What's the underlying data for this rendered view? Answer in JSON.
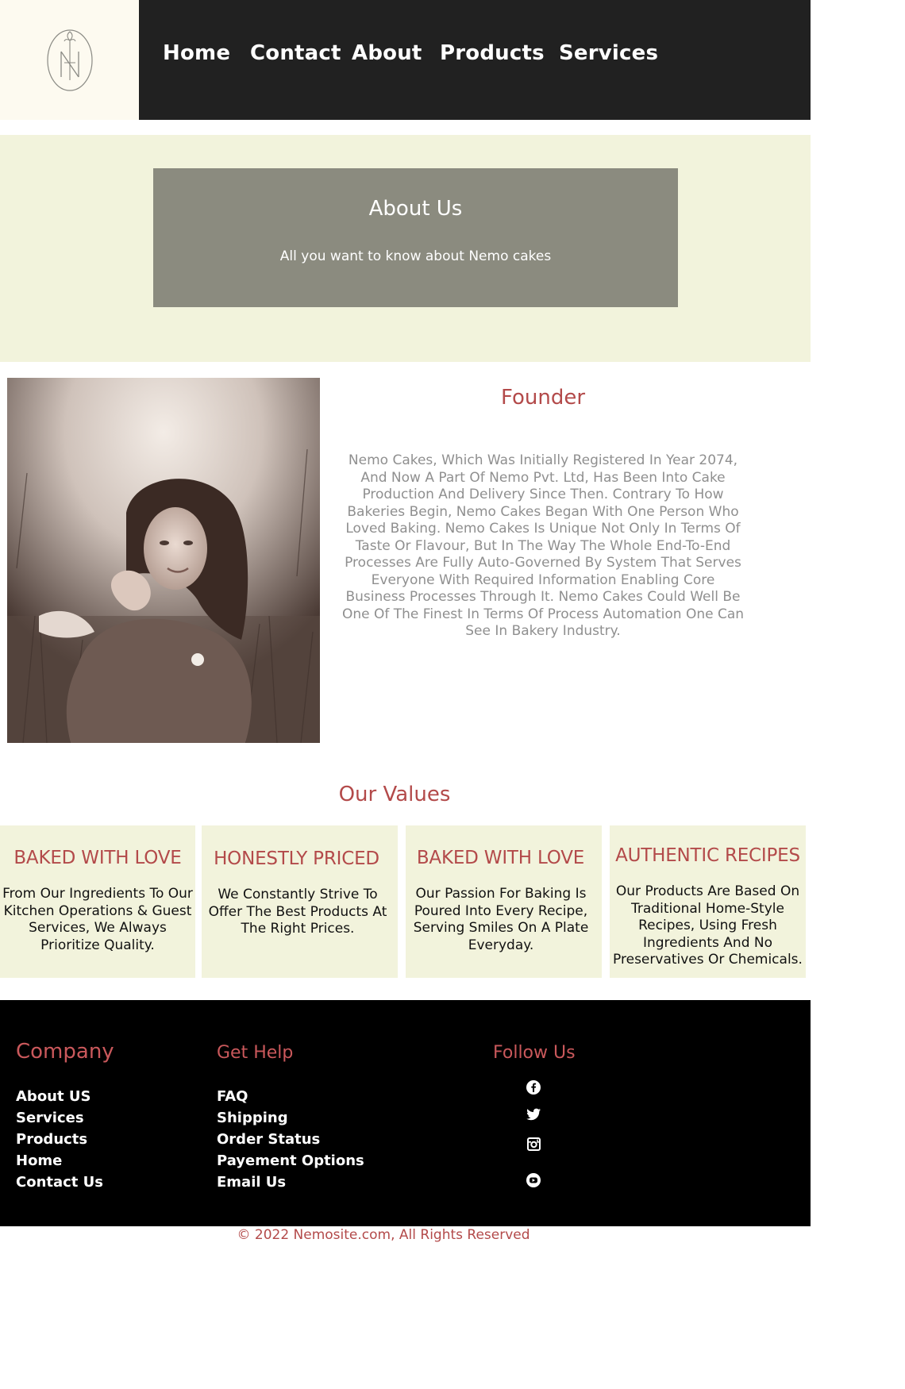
{
  "nav": {
    "items": [
      {
        "label": "Home"
      },
      {
        "label": "Contact"
      },
      {
        "label": "About"
      },
      {
        "label": "Products"
      },
      {
        "label": "Services"
      }
    ]
  },
  "hero": {
    "title": "About Us",
    "subtitle": "All you want to know about Nemo cakes"
  },
  "founder": {
    "title": "Founder",
    "text": "Nemo Cakes, Which Was Initially Registered In Year 2074, And Now A Part Of Nemo Pvt. Ltd, Has Been Into Cake Production And Delivery Since Then. Contrary To How Bakeries Begin, Nemo Cakes Began With One Person Who Loved Baking. Nemo Cakes Is Unique Not Only In Terms Of Taste Or Flavour, But In The Way The Whole End-To-End Processes Are Fully Auto-Governed By System That Serves Everyone With Required Information Enabling Core Business Processes Through It. Nemo Cakes Could Well Be One Of The Finest In Terms Of Process Automation One Can See In Bakery Industry."
  },
  "values": {
    "title": "Our Values",
    "cards": [
      {
        "heading": "BAKED WITH LOVE",
        "text": "From Our Ingredients To Our Kitchen Operations & Guest Services, We Always Prioritize Quality."
      },
      {
        "heading": "HONESTLY PRICED",
        "text": "We Constantly Strive To Offer The Best Products At The Right Prices."
      },
      {
        "heading": "BAKED WITH LOVE",
        "text": "Our Passion For Baking Is Poured Into Every Recipe, Serving Smiles On A Plate Everyday."
      },
      {
        "heading": "AUTHENTIC RECIPES",
        "text": "Our Products Are Based On Traditional Home-Style Recipes, Using Fresh Ingredients And No Preservatives Or Chemicals."
      }
    ]
  },
  "footer": {
    "company": {
      "heading": "Company",
      "links": [
        "About US",
        "Services",
        "Products",
        "Home",
        "Contact Us"
      ]
    },
    "help": {
      "heading": "Get Help",
      "links": [
        "FAQ",
        "Shipping",
        "Order Status",
        "Payement Options",
        "Email Us"
      ]
    },
    "follow": {
      "heading": "Follow Us",
      "icons": [
        "facebook-icon",
        "twitter-icon",
        "instagram-icon",
        "youtube-icon"
      ]
    },
    "copyright": "© 2022 Nemosite.com, All Rights Reserved"
  },
  "colors": {
    "accent": "#b34a4a",
    "nav_bg": "#212121",
    "cream": "#f2f3dc",
    "hero_card": "#8b8b7f",
    "footer_bg": "#000000"
  }
}
